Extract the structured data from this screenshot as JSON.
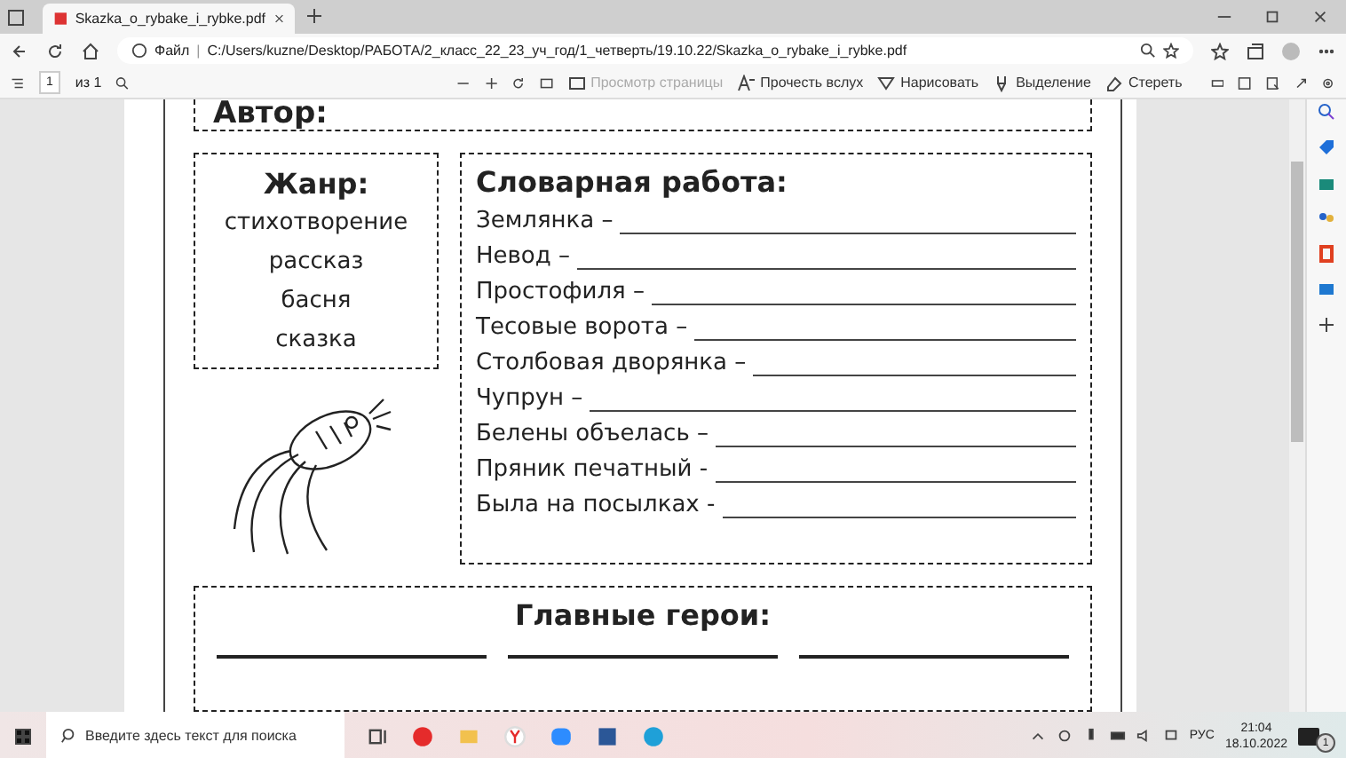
{
  "browser": {
    "tab_title": "Skazka_o_rybake_i_rybke.pdf",
    "address_label": "Файл",
    "address_separator": "|",
    "address": "C:/Users/kuzne/Desktop/РАБОТА/2_класс_22_23_уч_год/1_четверть/19.10.22/Skazka_o_rybake_i_rybke.pdf"
  },
  "pdf_toolbar": {
    "page": "1",
    "page_total": "из 1",
    "buttons": [
      {
        "label": "Просмотр страницы",
        "disabled": true
      },
      {
        "label": "Прочесть вслух",
        "disabled": false
      },
      {
        "label": "Нарисовать",
        "disabled": false
      },
      {
        "label": "Выделение",
        "disabled": false
      },
      {
        "label": "Стереть",
        "disabled": false
      }
    ]
  },
  "document": {
    "author_label": "Автор:",
    "genre": {
      "title": "Жанр:",
      "items": [
        "стихотворение",
        "рассказ",
        "басня",
        "сказка"
      ]
    },
    "vocabulary": {
      "title": "Словарная работа:",
      "items": [
        "Землянка –",
        "Невод –",
        "Простофиля –",
        "Тесовые ворота –",
        "Столбовая дворянка –",
        "Чупрун –",
        "Белены объелась –",
        "Пряник печатный -",
        "Была на посылках -"
      ]
    },
    "heroes": {
      "title": "Главные герои:"
    }
  },
  "taskbar": {
    "search_placeholder": "Введите здесь текст для поиска",
    "language": "РУС",
    "time": "21:04",
    "date": "18.10.2022",
    "notifications": "1"
  }
}
